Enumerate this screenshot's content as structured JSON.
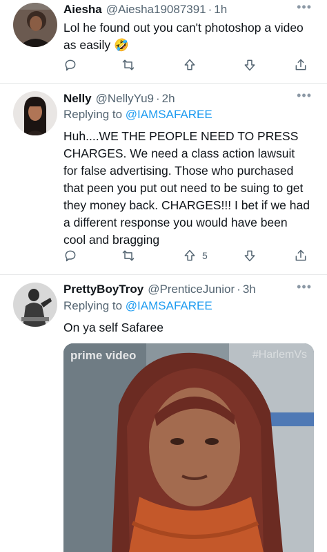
{
  "tweets": [
    {
      "name": "Aiesha",
      "handle": "@Aiesha19087391",
      "time": "1h",
      "more": "•••",
      "text": "Lol he found out you can't photoshop a video as easily 🤣",
      "actions": {
        "upvote_count": ""
      }
    },
    {
      "name": "Nelly",
      "handle": "@NellyYu9",
      "time": "2h",
      "more": "•••",
      "replying_prefix": "Replying to ",
      "replying_to": "@IAMSAFAREE",
      "text": "Huh....WE THE PEOPLE NEED TO PRESS CHARGES. We need a class action lawsuit for false advertising. Those who purchased that peen you put out need to be suing to get they money back. CHARGES!!! I bet if we had a different response you would have been cool and bragging",
      "actions": {
        "upvote_count": "5"
      }
    },
    {
      "name": "PrettyBoyTroy",
      "handle": "@PrenticeJunior",
      "time": "3h",
      "more": "•••",
      "replying_prefix": "Replying to ",
      "replying_to": "@IAMSAFAREE",
      "text": "On ya self Safaree",
      "media": {
        "watermark_left": "prime video",
        "watermark_right": "#HarlemVs"
      }
    }
  ],
  "separator": "·",
  "icons": [
    "reply-icon",
    "retweet-icon",
    "upvote-icon",
    "downvote-icon",
    "share-icon",
    "more-icon"
  ],
  "colors": {
    "link": "#1d9bf0",
    "muted": "#536471",
    "divider": "#e7e9ea"
  }
}
